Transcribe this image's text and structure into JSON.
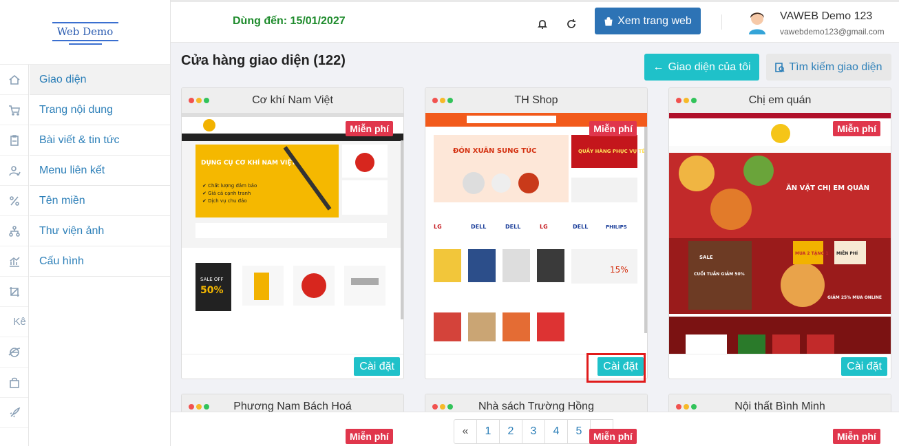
{
  "brand": {
    "logo_text": "Web Demo"
  },
  "sidebar": {
    "icons": [
      "home-icon",
      "cart-icon",
      "clipboard-icon",
      "user-icon",
      "percent-icon",
      "sitemap-icon",
      "chart-icon",
      "crop-icon",
      "ke-label",
      "ie-icon",
      "bag-icon",
      "rocket-icon"
    ],
    "ke_text": "Kê",
    "items": [
      {
        "label": "Giao diện"
      },
      {
        "label": "Trang nội dung"
      },
      {
        "label": "Bài viết & tin tức"
      },
      {
        "label": "Menu liên kết"
      },
      {
        "label": "Tên miền"
      },
      {
        "label": "Thư viện ảnh"
      },
      {
        "label": "Cấu hình"
      }
    ]
  },
  "header": {
    "expiry": "Dùng đến: 15/01/2027",
    "view_site": "Xem trang web",
    "user_name": "VAWEB Demo 123",
    "user_email": "vawebdemo123@gmail.com"
  },
  "main": {
    "title": "Cửa hàng giao diện (122)",
    "my_themes": "Giao diện của tôi",
    "search_themes": "Tìm kiếm giao diện",
    "free_badge": "Miễn phí",
    "install_label": "Cài đặt",
    "cards": [
      {
        "name": "Cơ khí Nam Việt"
      },
      {
        "name": "TH Shop"
      },
      {
        "name": "Chị em quán"
      },
      {
        "name": "Phương Nam Bách Hoá"
      },
      {
        "name": "Nhà sách Trường Hồng"
      },
      {
        "name": "Nội thất Bình Minh"
      }
    ],
    "previews": {
      "c1_banner": "DỤNG CỤ CƠ KHÍ NAM VIỆT",
      "c1_b1": "✔ Chất lượng đảm bảo",
      "c1_b2": "✔ Giá cả cạnh tranh",
      "c1_b3": "✔ Dịch vụ chu đáo",
      "c1_sale": "SALE OFF",
      "c1_pct": "50%",
      "c2_banner": "ĐÓN XUÂN SUNG TÚC",
      "c2_side": "QUẦY HÀNG PHỤC VỤ TẾT",
      "c2_brands": [
        "LG",
        "DELL",
        "DELL",
        "LG",
        "DELL",
        "PHILIPS"
      ],
      "c2_pct": "15%",
      "c3_title": "ĂN VẶT CHỊ EM QUÁN",
      "c3_sale": "SALE",
      "c3_weekend": "CUỐI TUẦN GIẢM 50%",
      "c3_buy": "MUA 2 TẶNG 1",
      "c3_free": "MIỄN PHÍ",
      "c3_online": "GIẢM 25% MUA ONLINE"
    }
  },
  "pagination": [
    "«",
    "1",
    "2",
    "3",
    "4",
    "5",
    "»"
  ],
  "colors": {
    "accent": "#1fc1c9",
    "primary": "#2d73b5",
    "badge": "#e0364c",
    "expiry": "#1e8b2c",
    "highlight": "#e01b1b"
  }
}
